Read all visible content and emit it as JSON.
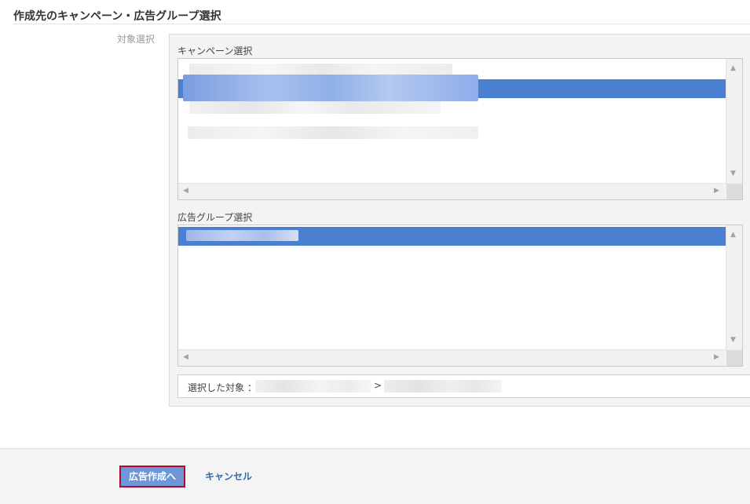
{
  "header": {
    "title": "作成先のキャンペーン・広告グループ選択"
  },
  "form": {
    "field_label": "対象選択",
    "campaign_label": "キャンペーン選択",
    "adgroup_label": "広告グループ選択",
    "selected_target_label": "選択した対象 ：",
    "separator": ">"
  },
  "campaign_list": {
    "items": [
      "[redacted]",
      "[redacted]",
      "[redacted]",
      "[redacted]"
    ],
    "selected_index": 1
  },
  "adgroup_list": {
    "items": [
      "[redacted]"
    ],
    "selected_index": 0
  },
  "footer": {
    "primary_button": "広告作成へ",
    "cancel_link": "キャンセル"
  },
  "colors": {
    "selection": "#4a7fd2",
    "primary": "#6f97d7",
    "highlight_border": "#b00830",
    "link": "#356aa8"
  },
  "icons": {
    "scroll_up": "▲",
    "scroll_down": "▼",
    "scroll_left": "◀",
    "scroll_right": "▶"
  }
}
